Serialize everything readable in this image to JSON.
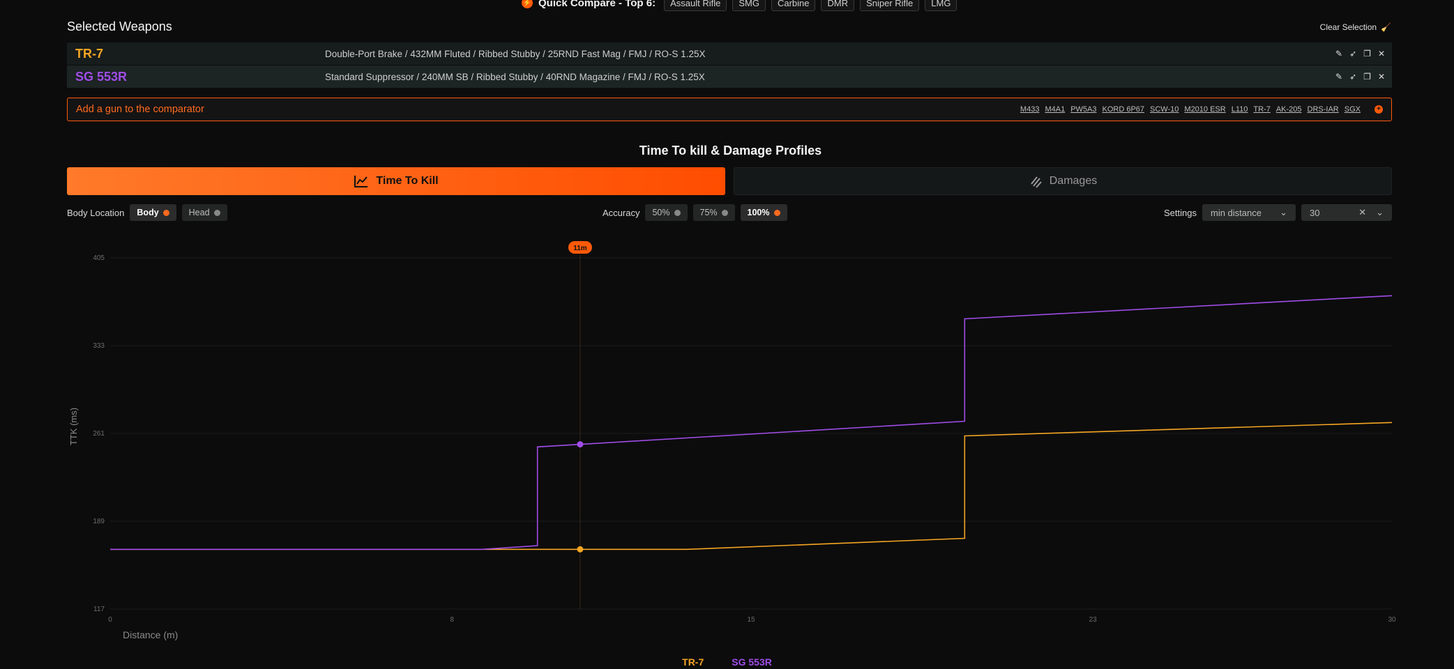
{
  "quick_compare": {
    "label": "Quick Compare - Top 6:",
    "buttons": [
      "Assault Rifle",
      "SMG",
      "Carbine",
      "DMR",
      "Sniper Rifle",
      "LMG"
    ]
  },
  "selected": {
    "title": "Selected Weapons",
    "clear_label": "Clear Selection",
    "weapons": [
      {
        "name": "TR-7",
        "build": "Double-Port Brake / 432MM Fluted / Ribbed Stubby / 25RND Fast Mag / FMJ / RO-S 1.25X",
        "color": "#f5a623"
      },
      {
        "name": "SG 553R",
        "build": "Standard Suppressor / 240MM SB / Ribbed Stubby / 40RND Magazine / FMJ / RO-S 1.25X",
        "color": "#a04de8"
      }
    ]
  },
  "add_gun": {
    "label": "Add a gun to the comparator",
    "links": [
      "M433",
      "M4A1",
      "PW5A3",
      "KORD 6P67",
      "SCW-10",
      "M2010 ESR",
      "L110",
      "TR-7",
      "AK-205",
      "DRS-IAR",
      "SGX"
    ]
  },
  "section_title": "Time To kill & Damage Profiles",
  "tabs": {
    "ttk": "Time To Kill",
    "damages": "Damages"
  },
  "filters": {
    "body_location_label": "Body Location",
    "body_location": [
      "Body",
      "Head"
    ],
    "accuracy_label": "Accuracy",
    "accuracy": [
      "50%",
      "75%",
      "100%"
    ],
    "settings_label": "Settings",
    "settings_mode": "min distance",
    "settings_value": "30"
  },
  "colors": {
    "accent": "#ff5a0a",
    "tr7": "#f5a623",
    "sg553r": "#a04de8"
  },
  "chart_data": {
    "type": "line",
    "title": "",
    "xlabel": "Distance (m)",
    "ylabel": "TTK (ms)",
    "xlim": [
      0,
      30
    ],
    "ylim": [
      117,
      405
    ],
    "xticks": [
      0,
      8,
      15,
      23,
      30
    ],
    "yticks": [
      117,
      189,
      261,
      333,
      405
    ],
    "cursor": {
      "x": 11,
      "label": "11m"
    },
    "series": [
      {
        "name": "TR-7",
        "color": "#f5a623",
        "points": [
          [
            0,
            166
          ],
          [
            13.5,
            166
          ],
          [
            20,
            175
          ],
          [
            20,
            259
          ],
          [
            30,
            270
          ]
        ]
      },
      {
        "name": "SG 553R",
        "color": "#a04de8",
        "points": [
          [
            0,
            166
          ],
          [
            8.7,
            166
          ],
          [
            10,
            169
          ],
          [
            10,
            250
          ],
          [
            20,
            271
          ],
          [
            20,
            355
          ],
          [
            30,
            374
          ]
        ]
      }
    ]
  }
}
